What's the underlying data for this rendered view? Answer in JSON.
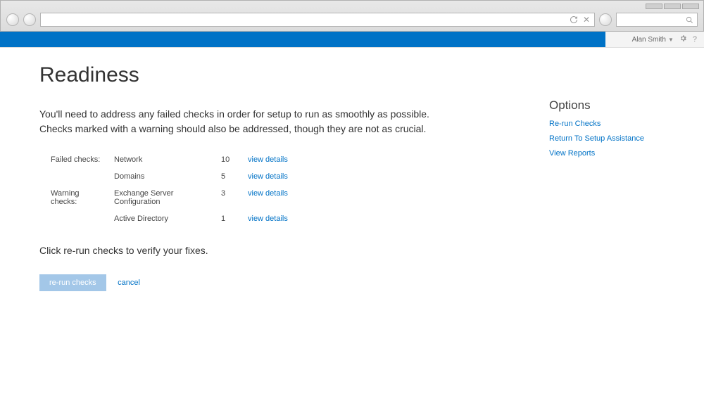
{
  "user": {
    "name": "Alan Smith"
  },
  "page": {
    "title": "Readiness",
    "intro_line1": "You'll need to address any failed checks in order for setup to run as smoothly as possible.",
    "intro_line2": "Checks marked with a warning should also be addressed, though they are not as crucial.",
    "footer_text": "Click re-run checks to verify your fixes.",
    "rerun_button": "re-run checks",
    "cancel_link": "cancel",
    "view_details_label": "view details"
  },
  "checks": {
    "failed_label": "Failed checks:",
    "warning_label": "Warning checks:",
    "rows": [
      {
        "category": "failed",
        "name": "Network",
        "count": "10"
      },
      {
        "category": "failed",
        "name": "Domains",
        "count": "5"
      },
      {
        "category": "warning",
        "name": "Exchange Server Configuration",
        "count": "3"
      },
      {
        "category": "warning",
        "name": "Active Directory",
        "count": "1"
      }
    ]
  },
  "sidebar": {
    "heading": "Options",
    "links": [
      "Re-run Checks",
      "Return To Setup Assistance",
      "View Reports"
    ]
  }
}
